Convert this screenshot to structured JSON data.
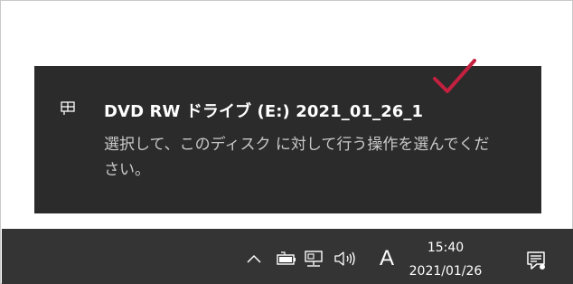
{
  "toast": {
    "title": "DVD RW ドライブ (E:) 2021_01_26_1",
    "body": "選択して、このディスク に対して行う操作を選んでください。",
    "icon": "drive-icon",
    "annotation": "checkmark-annotation"
  },
  "taskbar": {
    "tray_icons": [
      "chevron-up-icon",
      "battery-icon",
      "network-icon",
      "volume-icon"
    ],
    "ime_indicator": "A",
    "clock": {
      "time": "15:40",
      "date": "2021/01/26"
    },
    "action_center_icon": "notification-icon"
  },
  "colors": {
    "toast_bg": "#2b2b2b",
    "taskbar_bg": "#343434",
    "annotation": "#c4203f"
  }
}
